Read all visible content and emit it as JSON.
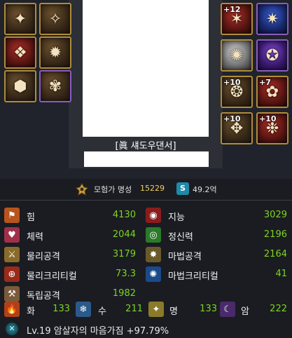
{
  "equipment": {
    "left": [
      {
        "icon": "shoulder-armor-icon",
        "glyph": "✦",
        "style": ""
      },
      {
        "icon": "chest-armor-icon",
        "glyph": "✧",
        "style": ""
      },
      {
        "icon": "belt-icon",
        "glyph": "❖",
        "style": "red"
      },
      {
        "icon": "pants-armor-icon",
        "glyph": "✹",
        "style": ""
      },
      {
        "icon": "boots-icon",
        "glyph": "⬢",
        "style": ""
      },
      {
        "icon": "weapon-doll-icon",
        "glyph": "✾",
        "style": "purple"
      }
    ],
    "right": [
      {
        "icon": "red-wrist-icon",
        "glyph": "✶",
        "style": "red",
        "enh": "+12"
      },
      {
        "icon": "blue-title-icon",
        "glyph": "✷",
        "style": "blue purple",
        "enh": ""
      },
      {
        "icon": "silver-helm-icon",
        "glyph": "✺",
        "style": "silver",
        "enh": ""
      },
      {
        "icon": "purple-orb-icon",
        "glyph": "✪",
        "style": "violet purple",
        "enh": ""
      },
      {
        "icon": "bracelet-icon",
        "glyph": "❂",
        "style": "",
        "enh": "+10"
      },
      {
        "icon": "ring-icon",
        "glyph": "✿",
        "style": "red",
        "enh": "+7"
      },
      {
        "icon": "earring-icon",
        "glyph": "✥",
        "style": "",
        "enh": "+10"
      },
      {
        "icon": "magic-stone-icon",
        "glyph": "❉",
        "style": "red",
        "enh": "+10"
      }
    ]
  },
  "character": {
    "name": "[眞 섀도우댄서]"
  },
  "fame": {
    "label": "모험가 명성",
    "value": "15229"
  },
  "gold": {
    "badge": "S",
    "value": "49.2억"
  },
  "stats": [
    {
      "label": "힘",
      "value": "4130",
      "icon": "strength-icon",
      "color": "#b8541c",
      "glyph": "⚑"
    },
    {
      "label": "지능",
      "value": "3029",
      "icon": "intelligence-icon",
      "color": "#8a1c1c",
      "glyph": "◉"
    },
    {
      "label": "체력",
      "value": "2044",
      "icon": "vitality-icon",
      "color": "#a0304a",
      "glyph": "♥"
    },
    {
      "label": "정신력",
      "value": "2196",
      "icon": "spirit-icon",
      "color": "#2a7a2a",
      "glyph": "◎"
    },
    {
      "label": "물리공격",
      "value": "3179",
      "icon": "physical-attack-icon",
      "color": "#8a6a2a",
      "glyph": "⚔"
    },
    {
      "label": "마법공격",
      "value": "2164",
      "icon": "magic-attack-icon",
      "color": "#6a5a2a",
      "glyph": "✸"
    },
    {
      "label": "물리크리티컬",
      "value": "73.3",
      "icon": "physical-critical-icon",
      "color": "#9a2a1a",
      "glyph": "⊕"
    },
    {
      "label": "마법크리티컬",
      "value": "41",
      "icon": "magic-critical-icon",
      "color": "#1a4a8a",
      "glyph": "✺"
    },
    {
      "label": "독립공격",
      "value": "1982",
      "icon": "independent-attack-icon",
      "color": "#7a5a3a",
      "glyph": "⚒"
    }
  ],
  "elements": [
    {
      "label": "화",
      "value": "133",
      "icon": "fire-element-icon",
      "color": "#b0401a",
      "glyph": "🔥"
    },
    {
      "label": "수",
      "value": "211",
      "icon": "water-element-icon",
      "color": "#2a5a8a",
      "glyph": "❄"
    },
    {
      "label": "명",
      "value": "133",
      "icon": "light-element-icon",
      "color": "#8a7a2a",
      "glyph": "✦"
    },
    {
      "label": "암",
      "value": "222",
      "icon": "dark-element-icon",
      "color": "#4a2a6a",
      "glyph": "☾"
    }
  ],
  "buff": {
    "text": "Lv.19 암살자의 마음가짐 +97.79%"
  }
}
